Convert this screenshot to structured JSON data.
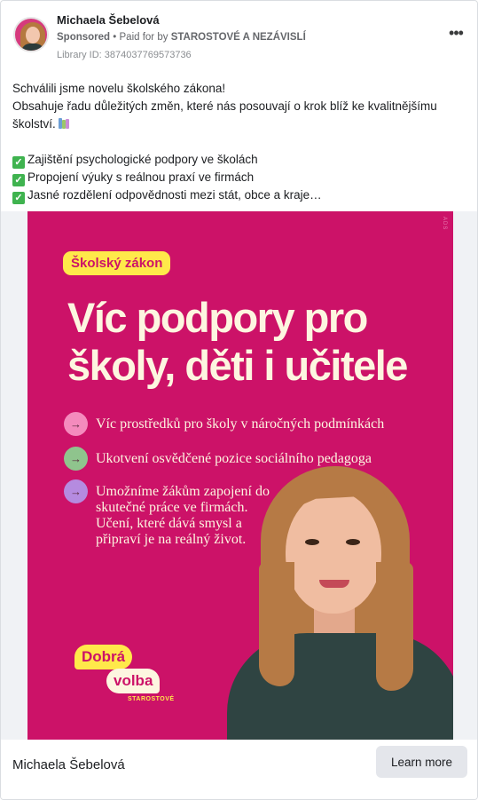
{
  "advertiser": {
    "name": "Michaela Šebelová",
    "sponsored_label": "Sponsored",
    "separator": "•",
    "paid_for_label": "Paid for by",
    "paid_for_by": "STAROSTOVÉ A NEZÁVISLÍ",
    "library_id": "Library ID: 3874037769573736",
    "more_icon": "more-dots-icon"
  },
  "post": {
    "line1": "Schválili jsme novelu školského zákona!",
    "line2": "Obsahuje řadu důležitých změn, které nás posouvají o krok blíž ke kvalitnějšímu školství.",
    "bullets": [
      "Zajištění psychologické podpory ve školách",
      "Propojení výuky s reálnou praxí ve firmách",
      "Jasné rozdělení odpovědnosti mezi stát, obce a kraje…"
    ],
    "check_icon": "check-mark-icon",
    "books_icon": "books-icon"
  },
  "creative": {
    "tag": "Školský zákon",
    "headline_line1": "Víc podpory pro",
    "headline_line2": "školy, děti i učitele",
    "points": [
      "Víc prostředků pro školy v náročných podmínkách",
      "Ukotvení osvědčené pozice sociálního pedagoga",
      "Umožníme žákům zapojení do skutečné práce ve firmách. Učení, které dává smysl a připraví je na reálný život."
    ],
    "arrow_icon": "arrow-right-icon",
    "arrow_colors": [
      "#f48bbd",
      "#8fc48d",
      "#b58be0"
    ],
    "logo_line1": "Dobrá",
    "logo_line2": "volba",
    "logo_brand": "STAROSTOVÉ",
    "background_color": "#cc1268",
    "accent_color": "#ffe94a"
  },
  "footer": {
    "name": "Michaela Šebelová",
    "cta_label": "Learn more"
  }
}
